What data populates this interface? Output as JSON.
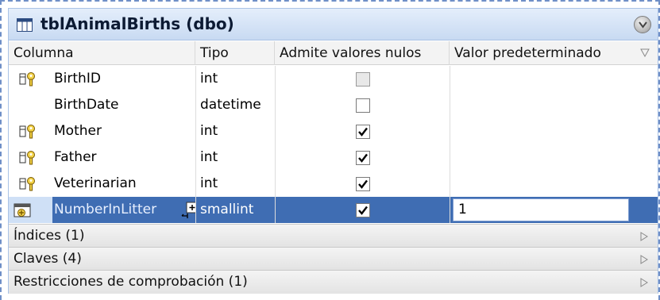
{
  "title": "tblAnimalBirths (dbo)",
  "headers": {
    "column": "Columna",
    "type": "Tipo",
    "nullable": "Admite valores nulos",
    "default": "Valor predeterminado"
  },
  "rows": [
    {
      "name": "BirthID",
      "type": "int",
      "key": true,
      "nullable": "disabled"
    },
    {
      "name": "BirthDate",
      "type": "datetime",
      "key": false,
      "nullable": "unchecked"
    },
    {
      "name": "Mother",
      "type": "int",
      "key": true,
      "nullable": "checked"
    },
    {
      "name": "Father",
      "type": "int",
      "key": true,
      "nullable": "checked"
    },
    {
      "name": "Veterinarian",
      "type": "int",
      "key": true,
      "nullable": "checked"
    },
    {
      "name": "NumberInLitter",
      "type": "smallint",
      "key": false,
      "nullable": "checked",
      "default": "1",
      "selected": true
    }
  ],
  "sections": {
    "indexes": "Índices (1)",
    "keys": "Claves (4)",
    "checks": "Restricciones de comprobación (1)"
  },
  "colors": {
    "selection": "#3f6db3",
    "titlebar": "#c8daf2"
  }
}
